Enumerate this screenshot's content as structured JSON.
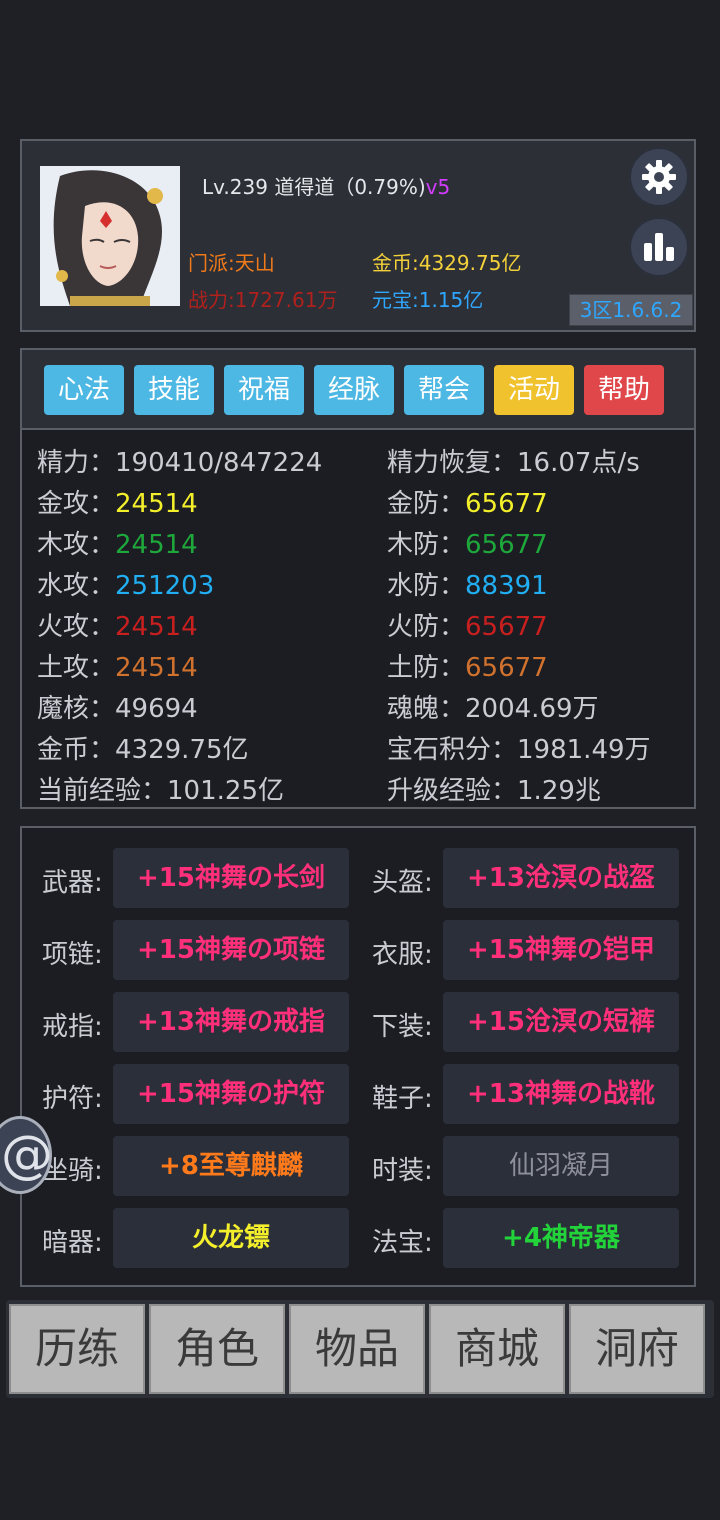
{
  "profile": {
    "level_line": "Lv.239 道得道（0.79%)",
    "vip": "v5",
    "sect": "门派:天山",
    "power": "战力:1727.61万",
    "gold": "金币:4329.75亿",
    "yuanbao": "元宝:1.15亿",
    "server": "3区1.6.6.2",
    "icons": {
      "settings": "gear-icon",
      "ranking": "bar-chart-icon",
      "avatar": "character-portrait"
    }
  },
  "tabs": [
    {
      "label": "心法",
      "color": "#4db8e3"
    },
    {
      "label": "技能",
      "color": "#4db8e3"
    },
    {
      "label": "祝福",
      "color": "#4db8e3"
    },
    {
      "label": "经脉",
      "color": "#4db8e3"
    },
    {
      "label": "帮会",
      "color": "#4db8e3"
    },
    {
      "label": "活动",
      "color": "#f0c22e"
    },
    {
      "label": "帮助",
      "color": "#e0474a"
    }
  ],
  "stats": {
    "left": [
      {
        "label": "精力：",
        "value": "190410/847224",
        "color": "#c9ccd3"
      },
      {
        "label": "金攻：",
        "value": "24514",
        "color": "#f3ef2b"
      },
      {
        "label": "木攻：",
        "value": "24514",
        "color": "#1ea83c"
      },
      {
        "label": "水攻：",
        "value": "251203",
        "color": "#21aef2"
      },
      {
        "label": "火攻：",
        "value": "24514",
        "color": "#c81f1f"
      },
      {
        "label": "土攻：",
        "value": "24514",
        "color": "#d0722e"
      },
      {
        "label": "魔核：",
        "value": "49694",
        "color": "#c9ccd3"
      },
      {
        "label": "金币：",
        "value": "4329.75亿",
        "color": "#c9ccd3"
      },
      {
        "label": "当前经验：",
        "value": "101.25亿",
        "color": "#c9ccd3"
      }
    ],
    "right": [
      {
        "label": "精力恢复：",
        "value": "16.07点/s",
        "color": "#c9ccd3"
      },
      {
        "label": "金防：",
        "value": "65677",
        "color": "#f3ef2b"
      },
      {
        "label": "木防：",
        "value": "65677",
        "color": "#1ea83c"
      },
      {
        "label": "水防：",
        "value": "88391",
        "color": "#21aef2"
      },
      {
        "label": "火防：",
        "value": "65677",
        "color": "#c81f1f"
      },
      {
        "label": "土防：",
        "value": "65677",
        "color": "#d0722e"
      },
      {
        "label": "魂魄：",
        "value": "2004.69万",
        "color": "#c9ccd3"
      },
      {
        "label": "宝石积分：",
        "value": "1981.49万",
        "color": "#c9ccd3"
      },
      {
        "label": "升级经验：",
        "value": "1.29兆",
        "color": "#c9ccd3"
      }
    ]
  },
  "equipment": {
    "left": [
      {
        "label": "武器:",
        "item": "+15神舞の长剑",
        "color": "#ff2f7a"
      },
      {
        "label": "项链:",
        "item": "+15神舞の项链",
        "color": "#ff2f7a"
      },
      {
        "label": "戒指:",
        "item": "+13神舞の戒指",
        "color": "#ff2f7a"
      },
      {
        "label": "护符:",
        "item": "+15神舞の护符",
        "color": "#ff2f7a"
      },
      {
        "label": "坐骑:",
        "item": "+8至尊麒麟",
        "color": "#ff7a1a"
      },
      {
        "label": "暗器:",
        "item": "火龙镖",
        "color": "#f3ef2b"
      }
    ],
    "right": [
      {
        "label": "头盔:",
        "item": "+13沧溟の战盔",
        "color": "#ff2f7a"
      },
      {
        "label": "衣服:",
        "item": "+15神舞の铠甲",
        "color": "#ff2f7a"
      },
      {
        "label": "下装:",
        "item": "+15沧溟の短裤",
        "color": "#ff2f7a"
      },
      {
        "label": "鞋子:",
        "item": "+13神舞の战靴",
        "color": "#ff2f7a"
      },
      {
        "label": "时装:",
        "item": "仙羽凝月",
        "color": "#8d9099"
      },
      {
        "label": "法宝:",
        "item": "+4神帝器",
        "color": "#22d33a"
      }
    ]
  },
  "nav": [
    "历练",
    "角色",
    "物品",
    "商城",
    "洞府"
  ],
  "float_button": "@"
}
